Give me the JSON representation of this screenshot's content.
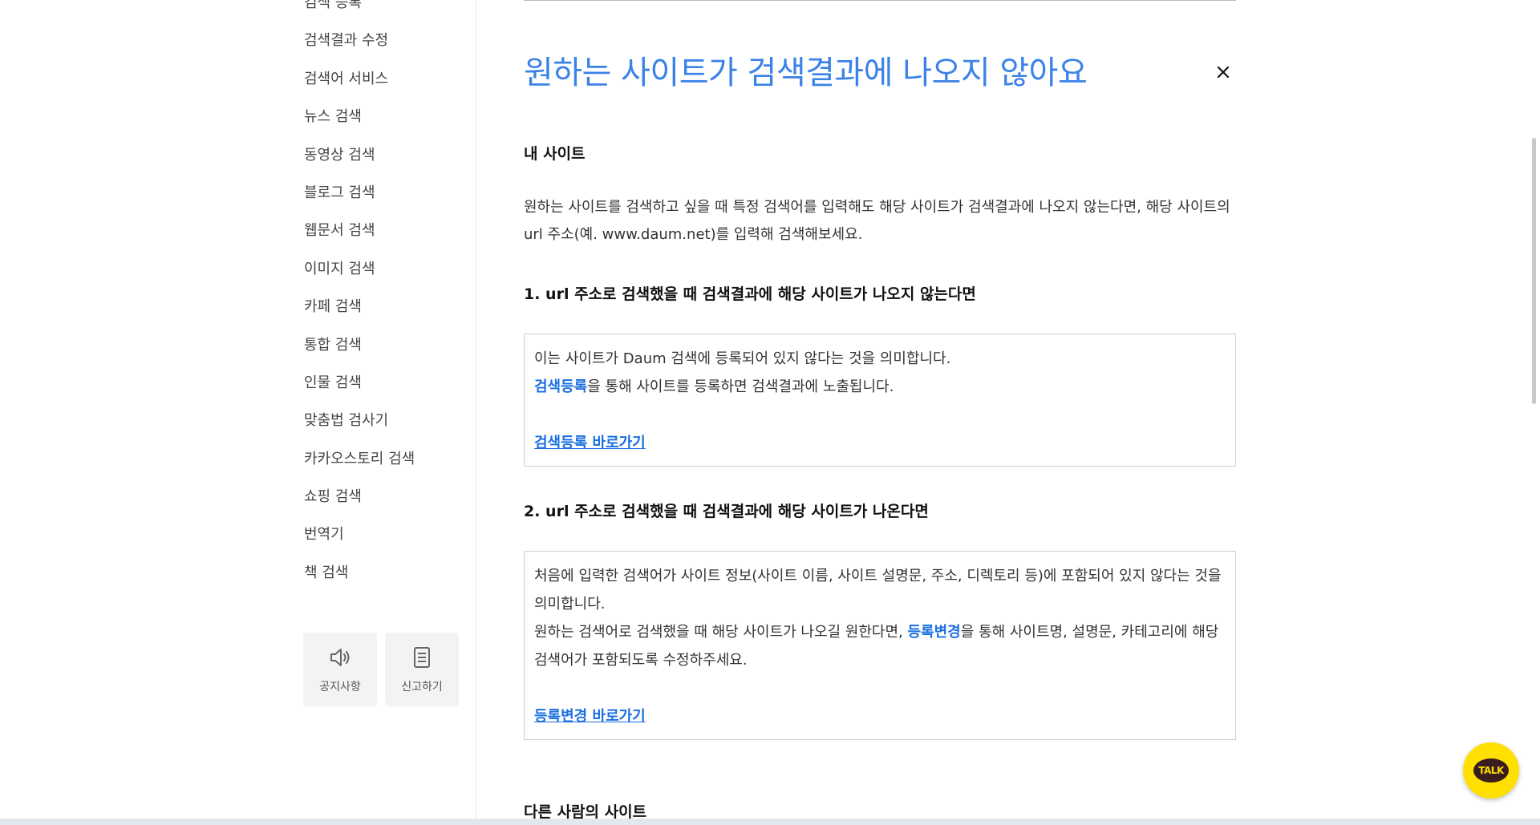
{
  "sidebar": {
    "items": [
      {
        "label": "검색 등록"
      },
      {
        "label": "검색결과 수정"
      },
      {
        "label": "검색어 서비스"
      },
      {
        "label": "뉴스 검색"
      },
      {
        "label": "동영상 검색"
      },
      {
        "label": "블로그 검색"
      },
      {
        "label": "웹문서 검색"
      },
      {
        "label": "이미지 검색"
      },
      {
        "label": "카페 검색"
      },
      {
        "label": "통합 검색"
      },
      {
        "label": "인물 검색"
      },
      {
        "label": "맞춤법 검사기"
      },
      {
        "label": "카카오스토리 검색"
      },
      {
        "label": "쇼핑 검색"
      },
      {
        "label": "번역기"
      },
      {
        "label": "책 검색"
      }
    ],
    "buttons": {
      "notice_label": "공지사항",
      "notice_icon": "speaker-icon",
      "report_label": "신고하기",
      "report_icon": "document-icon"
    }
  },
  "article": {
    "title": "원하는 사이트가 검색결과에 나오지 않아요",
    "section1_heading": "내 사이트",
    "intro_paragraph": "원하는 사이트를 검색하고 싶을 때 특정 검색어를 입력해도 해당 사이트가 검색결과에 나오지 않는다면, 해당 사이트의 url 주소(예. www.daum.net)를 입력해 검색해보세요.",
    "case1": {
      "heading": "1. url 주소로 검색했을 때 검색결과에 해당 사이트가 나오지 않는다면",
      "line1": "이는 사이트가 Daum 검색에 등록되어 있지 않다는 것을 의미합니다.",
      "link_inline": "검색등록",
      "line2_rest": "을 통해 사이트를 등록하면 검색결과에 노출됩니다.",
      "shortcut_link": "검색등록 바로가기"
    },
    "case2": {
      "heading": "2. url 주소로 검색했을 때 검색결과에 해당 사이트가 나온다면",
      "line1": "처음에 입력한 검색어가 사이트 정보(사이트 이름, 사이트 설명문, 주소, 디렉토리 등)에 포함되어 있지 않다는 것을 의미합니다.",
      "line2_pre": "원하는 검색어로 검색했을 때 해당 사이트가 나오길 원한다면, ",
      "link_inline": "등록변경",
      "line2_rest": "을 통해 사이트명, 설명문, 카테고리에 해당 검색어가 포함되도록 수정하주세요.",
      "shortcut_link": "등록변경 바로가기"
    },
    "section2_heading": "다른 사람의 사이트"
  },
  "talk_button": {
    "label": "TALK"
  },
  "colors": {
    "title_blue": "#3b82e8",
    "link_blue": "#1a6fe0",
    "talk_yellow": "#ffe001"
  }
}
